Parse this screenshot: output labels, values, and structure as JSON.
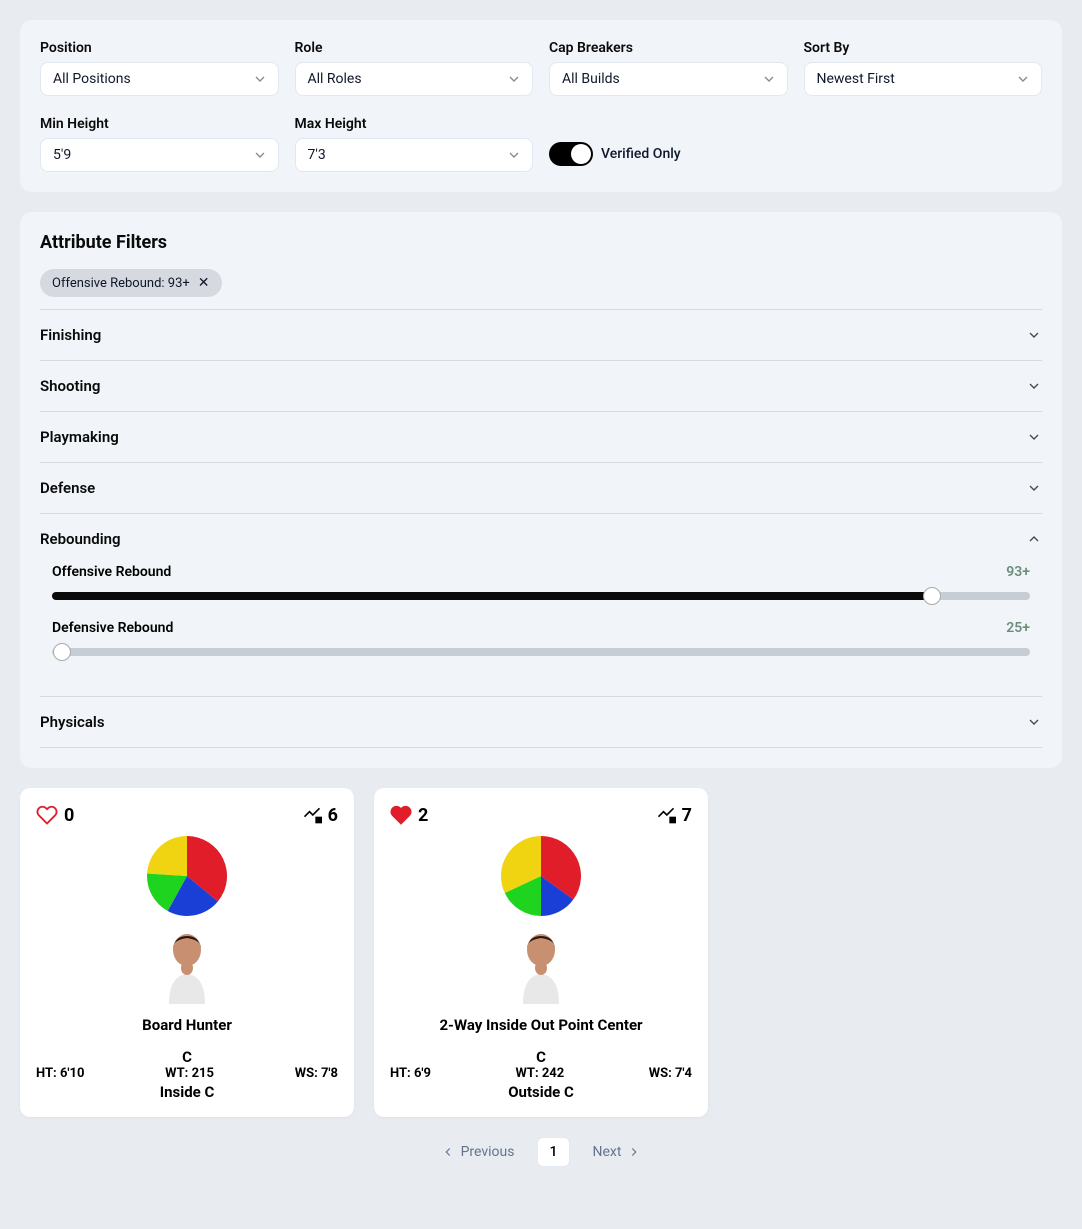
{
  "filters": {
    "position": {
      "label": "Position",
      "value": "All Positions"
    },
    "role": {
      "label": "Role",
      "value": "All Roles"
    },
    "cap_breakers": {
      "label": "Cap Breakers",
      "value": "All Builds"
    },
    "sort_by": {
      "label": "Sort By",
      "value": "Newest First"
    },
    "min_height": {
      "label": "Min Height",
      "value": "5'9"
    },
    "max_height": {
      "label": "Max Height",
      "value": "7'3"
    },
    "verified": {
      "label": "Verified Only",
      "on": true
    }
  },
  "attribute_filters": {
    "title": "Attribute Filters",
    "active_chip": "Offensive Rebound: 93+",
    "sections": [
      {
        "label": "Finishing",
        "open": false
      },
      {
        "label": "Shooting",
        "open": false
      },
      {
        "label": "Playmaking",
        "open": false
      },
      {
        "label": "Defense",
        "open": false
      },
      {
        "label": "Rebounding",
        "open": true,
        "sliders": [
          {
            "name": "Offensive Rebound",
            "value": "93+",
            "percent": 90
          },
          {
            "name": "Defensive Rebound",
            "value": "25+",
            "percent": 0
          }
        ]
      },
      {
        "label": "Physicals",
        "open": false
      }
    ]
  },
  "builds": [
    {
      "likes": "0",
      "liked": false,
      "caps": "6",
      "name": "Board Hunter",
      "ht": "HT: 6'10",
      "wt": "WT: 215",
      "ws": "WS: 7'8",
      "pos": "C",
      "role": "Inside C",
      "pie": {
        "red": 36,
        "blue": 22,
        "green": 18,
        "yellow": 24
      }
    },
    {
      "likes": "2",
      "liked": true,
      "caps": "7",
      "name": "2-Way Inside Out Point Center",
      "ht": "HT: 6'9",
      "wt": "WT: 242",
      "ws": "WS: 7'4",
      "pos": "C",
      "role": "Outside C",
      "pie": {
        "red": 35,
        "blue": 15,
        "green": 18,
        "yellow": 32
      }
    }
  ],
  "pagination": {
    "prev": "Previous",
    "next": "Next",
    "page": "1"
  }
}
